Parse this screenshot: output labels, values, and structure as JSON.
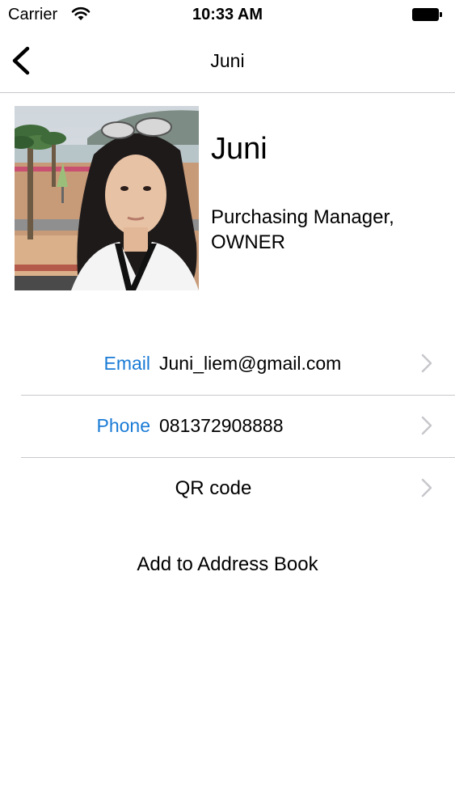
{
  "status_bar": {
    "carrier": "Carrier",
    "time": "10:33 AM",
    "wifi_icon": "wifi-icon",
    "battery_icon": "battery-icon"
  },
  "nav": {
    "title": "Juni",
    "back_icon": "chevron-left-icon"
  },
  "profile": {
    "name": "Juni",
    "role": "Purchasing Manager,\nOWNER"
  },
  "details": {
    "email": {
      "label": "Email",
      "value": "Juni_liem@gmail.com"
    },
    "phone": {
      "label": "Phone",
      "value": "081372908888"
    },
    "qr": {
      "label": "QR code"
    }
  },
  "actions": {
    "add_to_address_book": "Add to Address Book"
  },
  "colors": {
    "accent": "#1a7bd6",
    "separator": "#c8c7cc",
    "chevron": "#c7c7cc"
  }
}
